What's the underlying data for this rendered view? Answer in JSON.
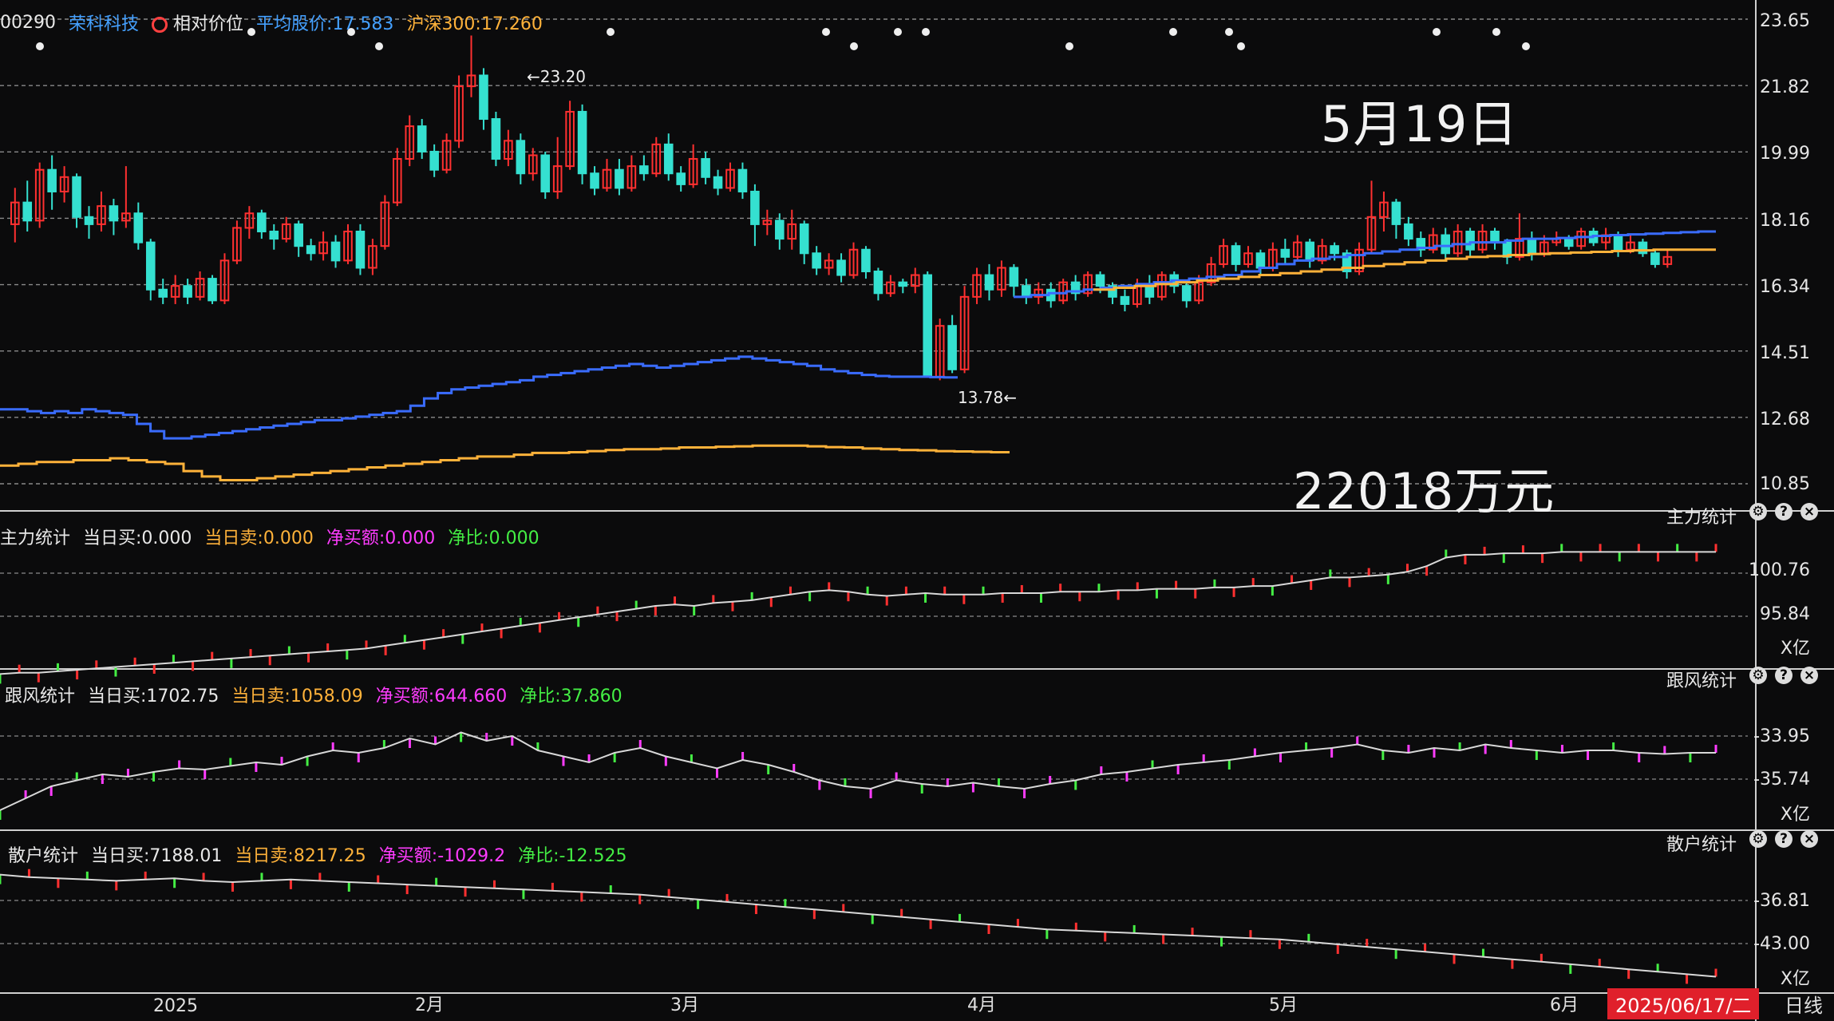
{
  "header": {
    "code": "00290",
    "name": "荣科科技",
    "relative": "相对价位",
    "avg_price": "平均股价:17.583",
    "index": "沪深300:17.260"
  },
  "overlay": {
    "date_note": "5月19日",
    "amount_note": "22018万元"
  },
  "price_axis": [
    "23.65",
    "21.82",
    "19.99",
    "18.16",
    "16.34",
    "14.51",
    "12.68",
    "10.85"
  ],
  "annotations": {
    "high": "23.20",
    "low": "13.78"
  },
  "panels": [
    {
      "title": "主力统计",
      "buy": "当日买:0.000",
      "sell": "当日卖:0.000",
      "net": "净买额:0.000",
      "ratio": "净比:0.000",
      "ticks": [
        "100.76",
        "95.84"
      ],
      "unit": "X亿"
    },
    {
      "title": "跟风统计",
      "buy": "当日买:1702.75",
      "sell": "当日卖:1058.09",
      "net": "净买额:644.660",
      "ratio": "净比:37.860",
      "ticks": [
        "-33.95",
        "-35.74"
      ],
      "unit": "X亿"
    },
    {
      "title": "散户统计",
      "buy": "当日买:7188.01",
      "sell": "当日卖:8217.25",
      "net": "净买额:-1029.2",
      "ratio": "净比:-12.525",
      "ticks": [
        "-36.81",
        "-43.00"
      ],
      "unit": "X亿"
    }
  ],
  "x_axis": {
    "months": [
      "2025",
      "2月",
      "3月",
      "4月",
      "5月",
      "6月"
    ],
    "date_box": "2025/06/17/二",
    "period": "日线"
  },
  "colors": {
    "up": "#ff3030",
    "down": "#35e0d0",
    "blue_line": "#3a6cff",
    "orange_line": "#ffb23a",
    "magenta": "#ff3cff",
    "green": "#44ee44"
  },
  "chart_data": {
    "type": "candlestick",
    "ylim": [
      10.85,
      23.65
    ],
    "candles": [
      [
        18.0,
        18.6,
        17.5,
        19.0
      ],
      [
        18.6,
        18.1,
        17.8,
        19.2
      ],
      [
        18.1,
        19.5,
        17.9,
        19.7
      ],
      [
        19.5,
        18.9,
        18.4,
        19.9
      ],
      [
        18.9,
        19.3,
        18.6,
        19.6
      ],
      [
        19.3,
        18.2,
        17.9,
        19.4
      ],
      [
        18.2,
        18.0,
        17.6,
        18.5
      ],
      [
        18.0,
        18.5,
        17.8,
        18.9
      ],
      [
        18.5,
        18.1,
        17.7,
        18.7
      ],
      [
        18.1,
        18.3,
        17.9,
        19.6
      ],
      [
        18.3,
        17.5,
        17.3,
        18.6
      ],
      [
        17.5,
        16.2,
        15.9,
        17.6
      ],
      [
        16.2,
        16.0,
        15.8,
        16.5
      ],
      [
        16.0,
        16.3,
        15.8,
        16.6
      ],
      [
        16.3,
        16.0,
        15.8,
        16.5
      ],
      [
        16.0,
        16.5,
        15.9,
        16.7
      ],
      [
        16.5,
        15.9,
        15.8,
        16.6
      ],
      [
        15.9,
        17.0,
        15.8,
        17.2
      ],
      [
        17.0,
        17.9,
        16.9,
        18.1
      ],
      [
        17.9,
        18.3,
        17.6,
        18.5
      ],
      [
        18.3,
        17.8,
        17.6,
        18.4
      ],
      [
        17.8,
        17.6,
        17.3,
        18.0
      ],
      [
        17.6,
        18.0,
        17.5,
        18.2
      ],
      [
        18.0,
        17.4,
        17.1,
        18.1
      ],
      [
        17.4,
        17.2,
        17.0,
        17.6
      ],
      [
        17.2,
        17.5,
        17.0,
        17.8
      ],
      [
        17.5,
        17.0,
        16.8,
        17.7
      ],
      [
        17.0,
        17.8,
        16.9,
        18.0
      ],
      [
        17.8,
        16.8,
        16.6,
        18.0
      ],
      [
        16.8,
        17.4,
        16.6,
        17.6
      ],
      [
        17.4,
        18.6,
        17.3,
        18.8
      ],
      [
        18.6,
        19.8,
        18.5,
        20.1
      ],
      [
        19.8,
        20.7,
        19.6,
        21.0
      ],
      [
        20.7,
        20.0,
        19.8,
        20.9
      ],
      [
        20.0,
        19.5,
        19.3,
        20.2
      ],
      [
        19.5,
        20.3,
        19.4,
        20.5
      ],
      [
        20.3,
        21.8,
        20.1,
        22.1
      ],
      [
        21.8,
        22.1,
        21.5,
        23.2
      ],
      [
        22.1,
        20.9,
        20.6,
        22.3
      ],
      [
        20.9,
        19.8,
        19.6,
        21.1
      ],
      [
        19.8,
        20.3,
        19.6,
        20.6
      ],
      [
        20.3,
        19.4,
        19.1,
        20.5
      ],
      [
        19.4,
        19.9,
        19.2,
        20.1
      ],
      [
        19.9,
        18.9,
        18.7,
        20.0
      ],
      [
        18.9,
        19.6,
        18.7,
        20.4
      ],
      [
        19.6,
        21.1,
        19.5,
        21.4
      ],
      [
        21.1,
        19.4,
        19.1,
        21.3
      ],
      [
        19.4,
        19.0,
        18.8,
        19.6
      ],
      [
        19.0,
        19.5,
        18.9,
        19.8
      ],
      [
        19.5,
        19.0,
        18.8,
        19.8
      ],
      [
        19.0,
        19.6,
        18.9,
        19.9
      ],
      [
        19.6,
        19.4,
        19.2,
        19.9
      ],
      [
        19.4,
        20.2,
        19.3,
        20.4
      ],
      [
        20.2,
        19.4,
        19.2,
        20.5
      ],
      [
        19.4,
        19.1,
        18.9,
        19.6
      ],
      [
        19.1,
        19.8,
        19.0,
        20.2
      ],
      [
        19.8,
        19.3,
        19.1,
        20.0
      ],
      [
        19.3,
        19.0,
        18.8,
        19.5
      ],
      [
        19.0,
        19.5,
        18.9,
        19.7
      ],
      [
        19.5,
        18.9,
        18.7,
        19.7
      ],
      [
        18.9,
        18.0,
        17.4,
        19.1
      ],
      [
        18.0,
        18.1,
        17.7,
        18.4
      ],
      [
        18.1,
        17.6,
        17.3,
        18.3
      ],
      [
        17.6,
        18.0,
        17.3,
        18.4
      ],
      [
        18.0,
        17.2,
        16.9,
        18.1
      ],
      [
        17.2,
        16.8,
        16.6,
        17.4
      ],
      [
        16.8,
        17.0,
        16.6,
        17.2
      ],
      [
        17.0,
        16.6,
        16.4,
        17.2
      ],
      [
        16.6,
        17.3,
        16.5,
        17.5
      ],
      [
        17.3,
        16.7,
        16.5,
        17.4
      ],
      [
        16.7,
        16.1,
        15.9,
        16.8
      ],
      [
        16.1,
        16.4,
        16.0,
        16.6
      ],
      [
        16.4,
        16.3,
        16.1,
        16.5
      ],
      [
        16.3,
        16.6,
        16.1,
        16.8
      ],
      [
        16.6,
        13.8,
        13.78,
        16.7
      ],
      [
        13.8,
        15.2,
        13.7,
        15.4
      ],
      [
        15.2,
        14.0,
        13.9,
        15.5
      ],
      [
        14.0,
        16.0,
        13.9,
        16.3
      ],
      [
        16.0,
        16.6,
        15.8,
        16.8
      ],
      [
        16.6,
        16.2,
        15.9,
        16.9
      ],
      [
        16.2,
        16.8,
        16.0,
        17.0
      ],
      [
        16.8,
        16.3,
        16.0,
        16.9
      ],
      [
        16.3,
        16.0,
        15.8,
        16.5
      ],
      [
        16.0,
        16.2,
        15.8,
        16.4
      ],
      [
        16.2,
        15.9,
        15.7,
        16.4
      ],
      [
        15.9,
        16.4,
        15.8,
        16.5
      ],
      [
        16.4,
        16.1,
        15.9,
        16.6
      ],
      [
        16.1,
        16.6,
        16.0,
        16.7
      ],
      [
        16.6,
        16.3,
        16.1,
        16.7
      ],
      [
        16.3,
        16.0,
        15.8,
        16.4
      ],
      [
        16.0,
        15.8,
        15.6,
        16.2
      ],
      [
        15.8,
        16.3,
        15.7,
        16.5
      ],
      [
        16.3,
        16.0,
        15.8,
        16.6
      ],
      [
        16.0,
        16.6,
        15.9,
        16.7
      ],
      [
        16.6,
        16.3,
        16.1,
        16.7
      ],
      [
        16.3,
        15.9,
        15.7,
        16.4
      ],
      [
        15.9,
        16.4,
        15.8,
        16.6
      ],
      [
        16.4,
        16.9,
        16.3,
        17.1
      ],
      [
        16.9,
        17.4,
        16.8,
        17.6
      ],
      [
        17.4,
        16.9,
        16.7,
        17.5
      ],
      [
        16.9,
        17.2,
        16.8,
        17.4
      ],
      [
        17.2,
        16.8,
        16.6,
        17.3
      ],
      [
        16.8,
        17.3,
        16.7,
        17.5
      ],
      [
        17.3,
        17.1,
        16.9,
        17.6
      ],
      [
        17.1,
        17.5,
        17.0,
        17.7
      ],
      [
        17.5,
        17.0,
        16.8,
        17.6
      ],
      [
        17.0,
        17.4,
        16.9,
        17.6
      ],
      [
        17.4,
        17.2,
        17.0,
        17.5
      ],
      [
        17.2,
        16.7,
        16.5,
        17.3
      ],
      [
        16.7,
        17.3,
        16.6,
        17.5
      ],
      [
        17.3,
        18.2,
        17.2,
        19.2
      ],
      [
        18.2,
        18.6,
        17.8,
        18.9
      ],
      [
        18.6,
        18.0,
        17.6,
        18.7
      ],
      [
        18.0,
        17.6,
        17.4,
        18.2
      ],
      [
        17.6,
        17.3,
        17.1,
        17.8
      ],
      [
        17.3,
        17.7,
        17.2,
        17.9
      ],
      [
        17.7,
        17.2,
        17.0,
        17.9
      ],
      [
        17.2,
        17.8,
        17.1,
        18.0
      ],
      [
        17.8,
        17.3,
        17.1,
        17.9
      ],
      [
        17.3,
        17.8,
        17.2,
        18.0
      ],
      [
        17.8,
        17.5,
        17.3,
        17.9
      ],
      [
        17.5,
        17.1,
        16.9,
        17.6
      ],
      [
        17.1,
        17.6,
        17.0,
        18.3
      ],
      [
        17.6,
        17.2,
        17.0,
        17.8
      ],
      [
        17.2,
        17.5,
        17.1,
        17.7
      ],
      [
        17.5,
        17.6,
        17.4,
        17.8
      ],
      [
        17.6,
        17.4,
        17.3,
        17.7
      ],
      [
        17.4,
        17.8,
        17.3,
        17.9
      ],
      [
        17.8,
        17.5,
        17.4,
        17.9
      ],
      [
        17.5,
        17.7,
        17.3,
        17.9
      ],
      [
        17.7,
        17.3,
        17.1,
        17.8
      ],
      [
        17.3,
        17.5,
        17.2,
        17.7
      ],
      [
        17.5,
        17.2,
        17.1,
        17.6
      ],
      [
        17.2,
        16.9,
        16.8,
        17.3
      ],
      [
        16.9,
        17.1,
        16.8,
        17.3
      ]
    ],
    "overlays": {
      "blue": [
        12.9,
        12.9,
        12.85,
        12.8,
        12.85,
        12.8,
        12.9,
        12.85,
        12.8,
        12.75,
        12.5,
        12.3,
        12.1,
        12.1,
        12.15,
        12.2,
        12.25,
        12.3,
        12.35,
        12.4,
        12.45,
        12.5,
        12.55,
        12.6,
        12.6,
        12.65,
        12.7,
        12.75,
        12.8,
        12.85,
        13.0,
        13.2,
        13.35,
        13.45,
        13.5,
        13.55,
        13.6,
        13.65,
        13.7,
        13.8,
        13.85,
        13.9,
        13.95,
        14.0,
        14.05,
        14.1,
        14.15,
        14.1,
        14.05,
        14.1,
        14.15,
        14.2,
        14.25,
        14.3,
        14.35,
        14.3,
        14.25,
        14.2,
        14.15,
        14.1,
        14.0,
        13.95,
        13.9,
        13.85,
        13.82,
        13.8,
        13.8,
        13.8,
        13.79,
        13.78
      ],
      "orange": [
        11.35,
        11.4,
        11.45,
        11.45,
        11.5,
        11.5,
        11.55,
        11.5,
        11.45,
        11.4,
        11.2,
        11.05,
        10.95,
        10.95,
        11.0,
        11.05,
        11.1,
        11.15,
        11.2,
        11.25,
        11.3,
        11.35,
        11.4,
        11.45,
        11.5,
        11.55,
        11.6,
        11.6,
        11.65,
        11.7,
        11.7,
        11.72,
        11.75,
        11.78,
        11.8,
        11.8,
        11.82,
        11.85,
        11.85,
        11.87,
        11.88,
        11.9,
        11.9,
        11.9,
        11.88,
        11.86,
        11.85,
        11.82,
        11.8,
        11.78,
        11.77,
        11.75,
        11.74,
        11.73,
        11.72
      ],
      "blue_late": [
        16.0,
        16.05,
        16.1,
        16.15,
        16.2,
        16.25,
        16.3,
        16.35,
        16.4,
        16.45,
        16.5,
        16.55,
        16.6,
        16.7,
        16.8,
        16.9,
        17.0,
        17.05,
        17.1,
        17.15,
        17.2,
        17.25,
        17.3,
        17.35,
        17.4,
        17.45,
        17.5,
        17.5,
        17.55,
        17.6,
        17.6,
        17.62,
        17.65,
        17.68,
        17.7,
        17.72,
        17.74,
        17.76,
        17.78,
        17.8
      ],
      "orange_late": [
        16.2,
        16.25,
        16.3,
        16.35,
        16.4,
        16.45,
        16.5,
        16.55,
        16.6,
        16.65,
        16.7,
        16.75,
        16.8,
        16.85,
        16.9,
        16.95,
        17.0,
        17.05,
        17.1,
        17.12,
        17.15,
        17.18,
        17.2,
        17.22,
        17.24,
        17.26,
        17.28,
        17.3,
        17.3,
        17.3
      ]
    },
    "panel_series": {
      "main": [
        0.02,
        0.03,
        0.03,
        0.04,
        0.05,
        0.06,
        0.07,
        0.08,
        0.09,
        0.1,
        0.11,
        0.12,
        0.13,
        0.14,
        0.15,
        0.16,
        0.17,
        0.18,
        0.19,
        0.2,
        0.22,
        0.24,
        0.26,
        0.28,
        0.3,
        0.32,
        0.34,
        0.36,
        0.38,
        0.4,
        0.42,
        0.44,
        0.46,
        0.48,
        0.5,
        0.51,
        0.5,
        0.52,
        0.53,
        0.54,
        0.56,
        0.58,
        0.6,
        0.61,
        0.6,
        0.58,
        0.57,
        0.58,
        0.59,
        0.58,
        0.58,
        0.58,
        0.59,
        0.59,
        0.59,
        0.6,
        0.6,
        0.6,
        0.61,
        0.61,
        0.62,
        0.62,
        0.62,
        0.63,
        0.63,
        0.64,
        0.64,
        0.66,
        0.68,
        0.7,
        0.7,
        0.71,
        0.72,
        0.74,
        0.78,
        0.84,
        0.86,
        0.86,
        0.87,
        0.87,
        0.87,
        0.88,
        0.88,
        0.88,
        0.88,
        0.88,
        0.88,
        0.88,
        0.88,
        0.88
      ],
      "follow": [
        0.1,
        0.2,
        0.3,
        0.35,
        0.4,
        0.38,
        0.42,
        0.45,
        0.44,
        0.47,
        0.5,
        0.48,
        0.55,
        0.6,
        0.58,
        0.62,
        0.7,
        0.65,
        0.75,
        0.68,
        0.72,
        0.6,
        0.55,
        0.5,
        0.58,
        0.62,
        0.55,
        0.5,
        0.45,
        0.52,
        0.48,
        0.42,
        0.35,
        0.3,
        0.28,
        0.35,
        0.32,
        0.3,
        0.33,
        0.3,
        0.28,
        0.32,
        0.35,
        0.4,
        0.42,
        0.45,
        0.48,
        0.5,
        0.52,
        0.55,
        0.58,
        0.6,
        0.62,
        0.65,
        0.6,
        0.58,
        0.62,
        0.6,
        0.65,
        0.62,
        0.6,
        0.58,
        0.6,
        0.6,
        0.58,
        0.57,
        0.58,
        0.58
      ],
      "retail": [
        0.9,
        0.88,
        0.87,
        0.86,
        0.85,
        0.86,
        0.87,
        0.85,
        0.84,
        0.85,
        0.86,
        0.85,
        0.84,
        0.83,
        0.82,
        0.81,
        0.8,
        0.79,
        0.78,
        0.77,
        0.76,
        0.75,
        0.74,
        0.72,
        0.7,
        0.68,
        0.66,
        0.64,
        0.62,
        0.6,
        0.58,
        0.56,
        0.54,
        0.52,
        0.5,
        0.48,
        0.46,
        0.45,
        0.44,
        0.43,
        0.42,
        0.41,
        0.4,
        0.39,
        0.38,
        0.36,
        0.34,
        0.32,
        0.3,
        0.28,
        0.26,
        0.24,
        0.22,
        0.2,
        0.18,
        0.16,
        0.14,
        0.12,
        0.1,
        0.08
      ]
    }
  }
}
